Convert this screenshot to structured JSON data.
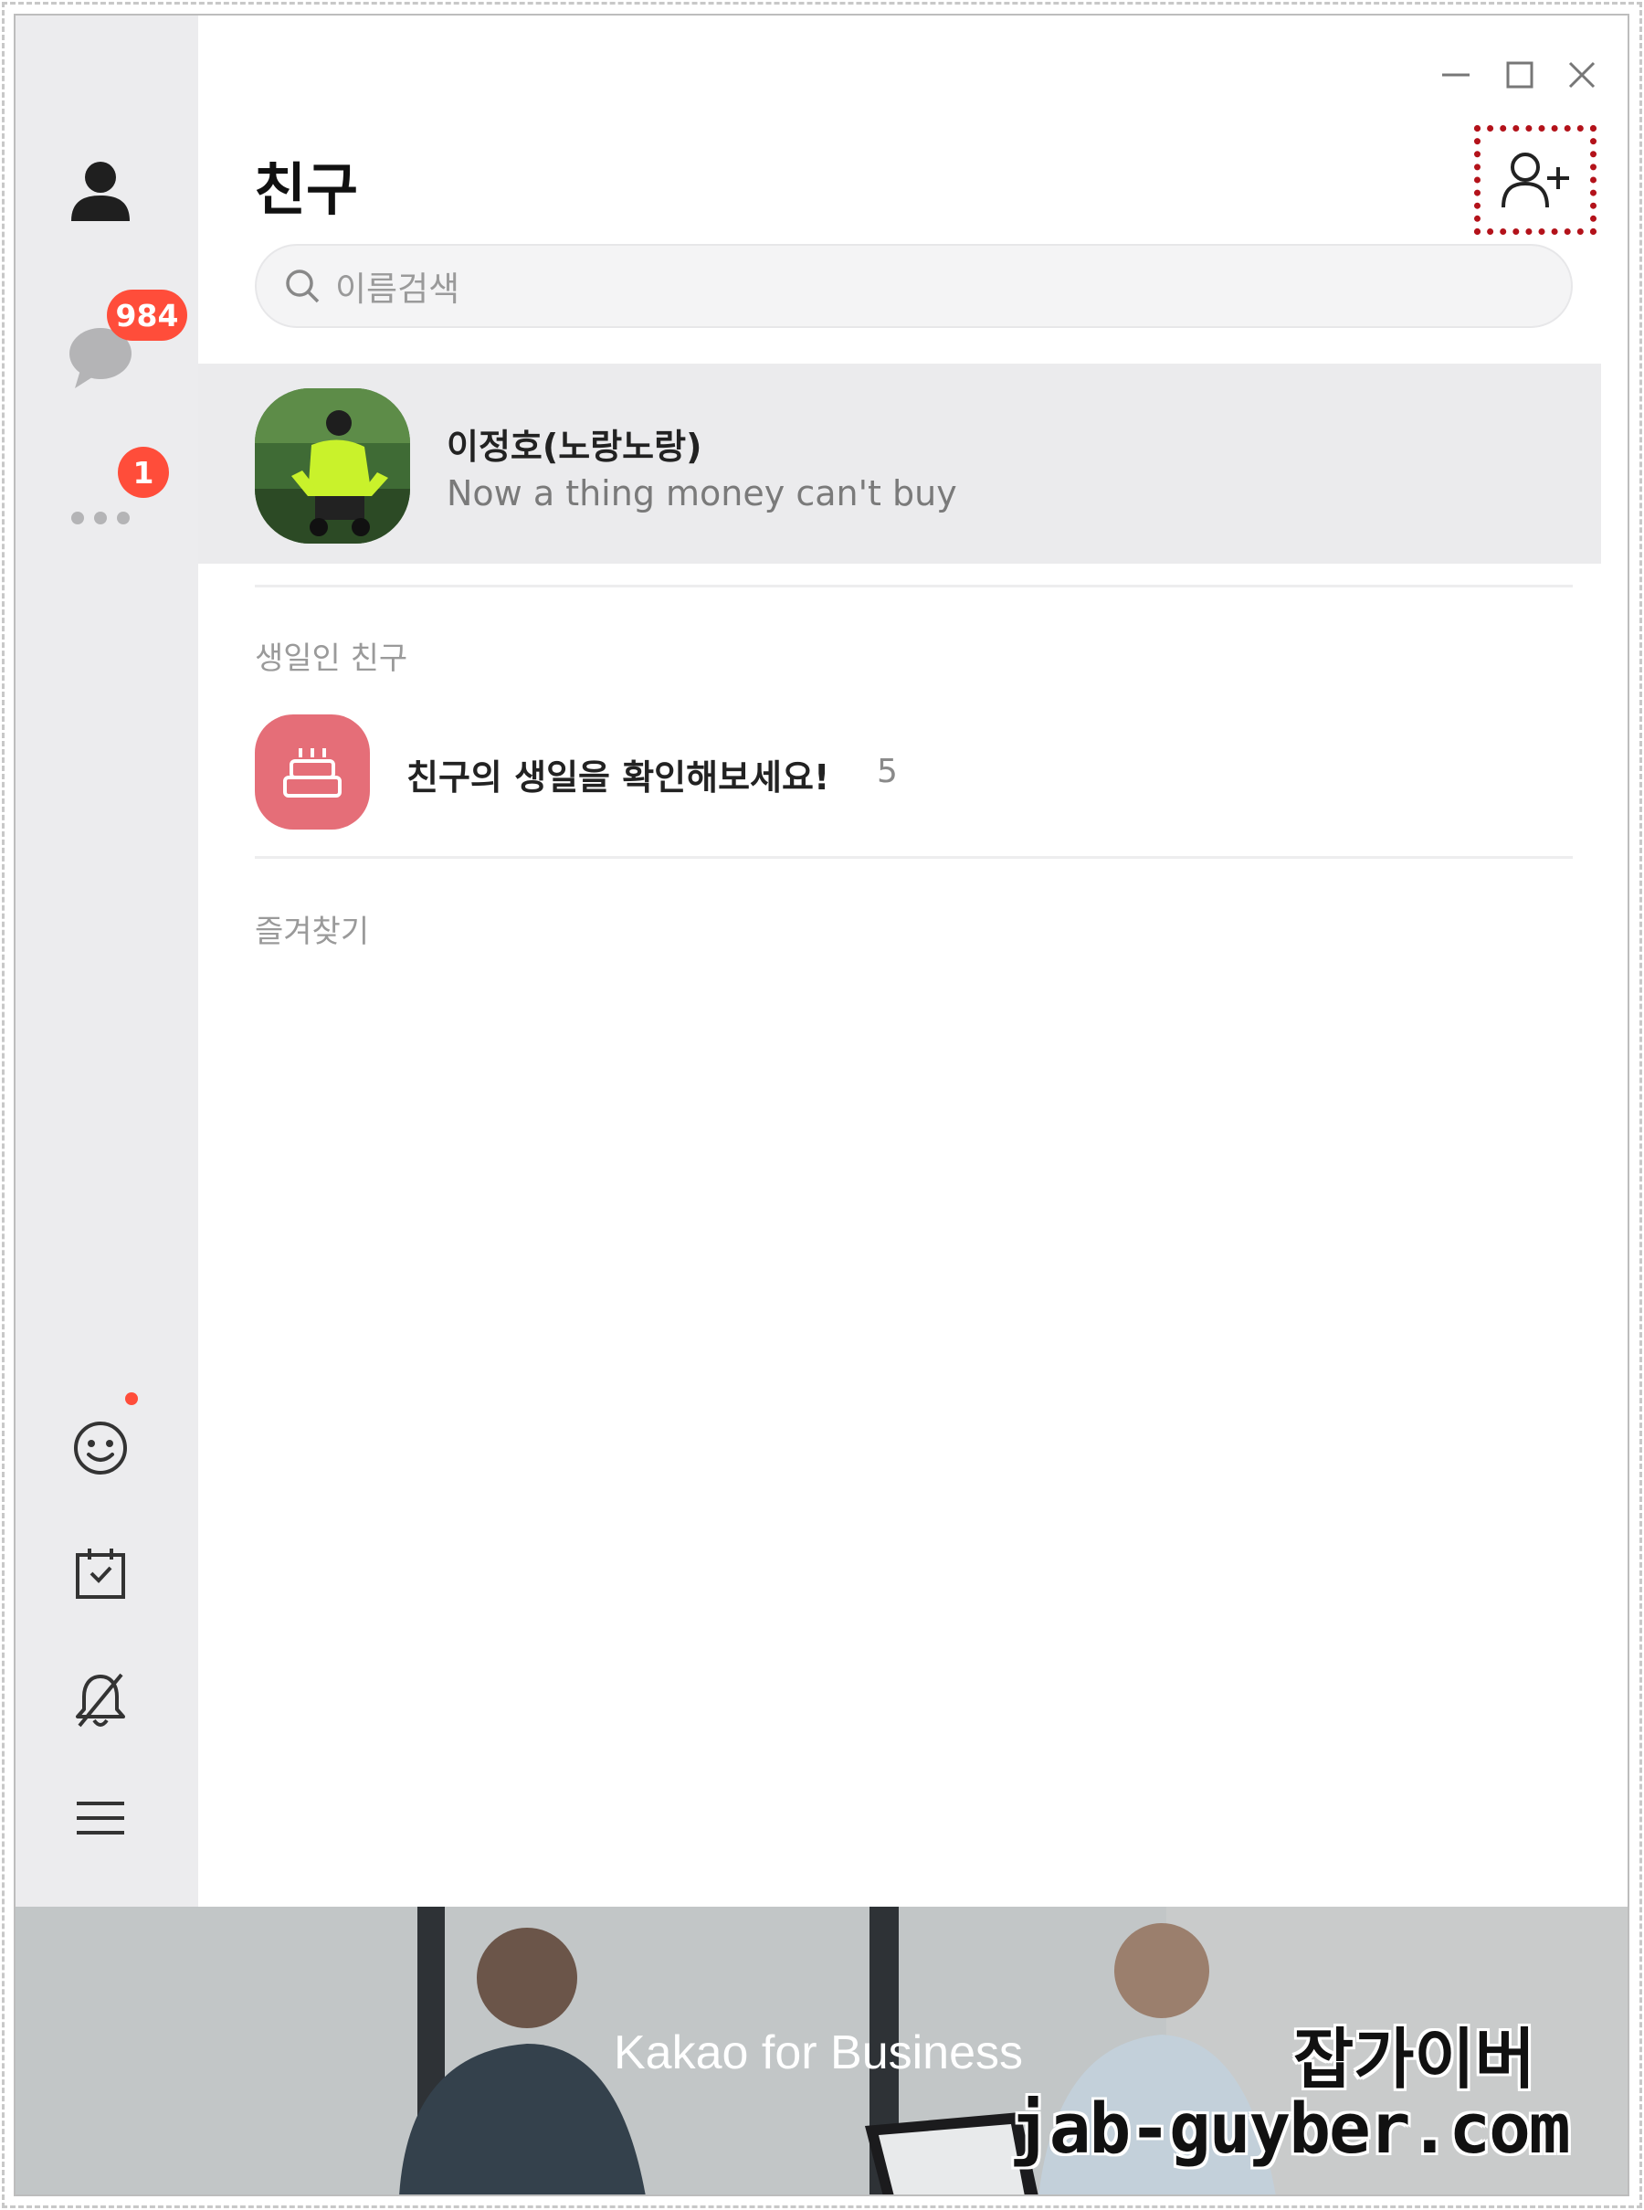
{
  "header": {
    "title": "친구"
  },
  "window_controls": {
    "minimize": "minimize-icon",
    "maximize": "maximize-icon",
    "close": "close-icon"
  },
  "sidebar": {
    "items": [
      {
        "name": "friends",
        "icon": "person-icon"
      },
      {
        "name": "chats",
        "icon": "chat-bubble-icon",
        "badge": "984"
      },
      {
        "name": "more",
        "icon": "more-dots-icon",
        "badge": "1"
      }
    ],
    "bottom_items": [
      {
        "name": "emoticon",
        "icon": "smiley-icon",
        "has_dot": true
      },
      {
        "name": "calendar",
        "icon": "calendar-check-icon"
      },
      {
        "name": "notifications",
        "icon": "bell-off-icon"
      },
      {
        "name": "menu",
        "icon": "hamburger-menu-icon"
      }
    ]
  },
  "search": {
    "placeholder": "이름검색"
  },
  "my_profile": {
    "name": "이정호(노랑노랑)",
    "status": "Now a thing money can't buy"
  },
  "birthday_section": {
    "label": "생일인 친구",
    "text": "친구의 생일을 확인해보세요!",
    "count": "5"
  },
  "favorites_section": {
    "label": "즐겨찾기"
  },
  "banner": {
    "text": "Kakao for Business"
  },
  "watermark": {
    "line1": "잡가이버",
    "line2": "jab-guyber.com"
  },
  "colors": {
    "badge": "#ff4d3a",
    "sidebar_bg": "#ececee",
    "highlight": "#b3121a",
    "birthday": "#e56e78"
  }
}
